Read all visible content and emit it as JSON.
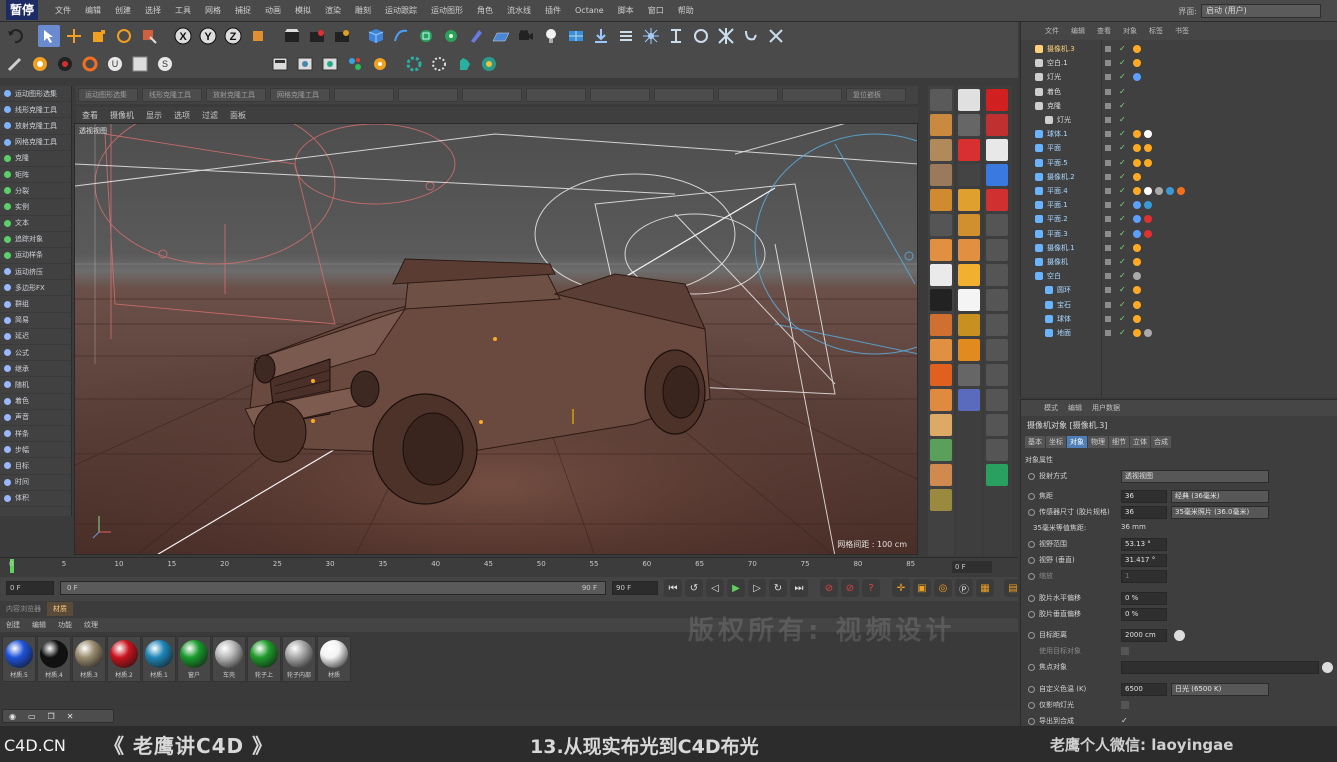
{
  "menubar": {
    "pause_badge": "暂停",
    "items": [
      "文件",
      "编辑",
      "创建",
      "选择",
      "工具",
      "网格",
      "捕捉",
      "动画",
      "模拟",
      "渲染",
      "雕刻",
      "运动跟踪",
      "运动图形",
      "角色",
      "流水线",
      "插件",
      "Octane",
      "脚本",
      "窗口",
      "帮助"
    ],
    "layout_label": "界面:",
    "layout_value": "启动 (用户)"
  },
  "toolbar1": {
    "axis_x": "X",
    "axis_y": "Y",
    "axis_z": "Z"
  },
  "row3": [
    "运动图形选集",
    "线形克隆工具",
    "放射克隆工具",
    "网格克隆工具",
    "",
    "",
    "",
    "",
    "",
    "",
    "",
    "",
    "复位嵌板"
  ],
  "left_panel": {
    "items": [
      {
        "label": "运动图形选集",
        "color": "#7fb2ff"
      },
      {
        "label": "线形克隆工具",
        "color": "#7fb2ff"
      },
      {
        "label": "放射克隆工具",
        "color": "#7fb2ff"
      },
      {
        "label": "网格克隆工具",
        "color": "#7fb2ff"
      },
      {
        "label": "克隆",
        "color": "#5ad06a"
      },
      {
        "label": "矩阵",
        "color": "#5ad06a"
      },
      {
        "label": "分裂",
        "color": "#5ad06a"
      },
      {
        "label": "实例",
        "color": "#5ad06a"
      },
      {
        "label": "文本",
        "color": "#5ad06a"
      },
      {
        "label": "追踪对象",
        "color": "#5ad06a"
      },
      {
        "label": "运动样条",
        "color": "#5ad06a"
      },
      {
        "label": "运动挤压",
        "color": "#9ab7ff"
      },
      {
        "label": "多边形FX",
        "color": "#9ab7ff"
      },
      {
        "label": "群组",
        "color": "#9ab7ff"
      },
      {
        "label": "简易",
        "color": "#9ab7ff"
      },
      {
        "label": "延迟",
        "color": "#9ab7ff"
      },
      {
        "label": "公式",
        "color": "#9ab7ff"
      },
      {
        "label": "继承",
        "color": "#9ab7ff"
      },
      {
        "label": "随机",
        "color": "#9ab7ff"
      },
      {
        "label": "着色",
        "color": "#9ab7ff"
      },
      {
        "label": "声音",
        "color": "#9ab7ff"
      },
      {
        "label": "样条",
        "color": "#9ab7ff"
      },
      {
        "label": "步幅",
        "color": "#9ab7ff"
      },
      {
        "label": "目标",
        "color": "#9ab7ff"
      },
      {
        "label": "时间",
        "color": "#9ab7ff"
      },
      {
        "label": "体积",
        "color": "#9ab7ff"
      }
    ]
  },
  "viewport": {
    "menu": [
      "查看",
      "摄像机",
      "显示",
      "选项",
      "过滤",
      "面板"
    ],
    "view_name": "透视视图",
    "grid_spacing": "网格间距 : 100 cm"
  },
  "timeline": {
    "ticks": [
      "0",
      "5",
      "10",
      "15",
      "20",
      "25",
      "30",
      "35",
      "40",
      "45",
      "50",
      "55",
      "60",
      "65",
      "70",
      "75",
      "80",
      "85",
      "90"
    ],
    "current": "0 F",
    "start": "0 F",
    "range_start": "0 F",
    "range_end": "90 F",
    "end": "90 F"
  },
  "materials": {
    "tabs": [
      "内容浏览器",
      "材质"
    ],
    "active_tab": "材质",
    "menu": [
      "创建",
      "编辑",
      "功能",
      "纹理"
    ],
    "items": [
      {
        "name": "材质.5",
        "color": "#1e52d8"
      },
      {
        "name": "材质.4",
        "color": "#111111"
      },
      {
        "name": "材质.3",
        "color": "#9a8c70"
      },
      {
        "name": "材质.2",
        "color": "#c8131d"
      },
      {
        "name": "材质.1",
        "color": "#1f86b8"
      },
      {
        "name": "窗户",
        "color": "#1a9a2d"
      },
      {
        "name": "车壳",
        "color": "#b9b9b9"
      },
      {
        "name": "轮子上",
        "color": "#1f9b2a"
      },
      {
        "name": "轮子内部",
        "color": "#a9a9a9"
      },
      {
        "name": "材质",
        "color": "#f3f3f3"
      }
    ]
  },
  "objects": {
    "menu": [
      "文件",
      "编辑",
      "查看",
      "对象",
      "标签",
      "书签"
    ],
    "rows": [
      {
        "name": "摄像机.3",
        "style": "sel",
        "indent": 0
      },
      {
        "name": "空白.1",
        "style": "plain",
        "indent": 0
      },
      {
        "name": "灯光",
        "style": "plain",
        "indent": 0
      },
      {
        "name": "着色",
        "style": "plain",
        "indent": 0
      },
      {
        "name": "克隆",
        "style": "plain",
        "indent": 0
      },
      {
        "name": "灯光",
        "style": "plain",
        "indent": 1
      },
      {
        "name": "球体.1",
        "style": "blue",
        "indent": 0
      },
      {
        "name": "平面",
        "style": "blue",
        "indent": 0
      },
      {
        "name": "平面.5",
        "style": "blue",
        "indent": 0
      },
      {
        "name": "摄像机.2",
        "style": "blue",
        "indent": 0
      },
      {
        "name": "平面.4",
        "style": "blue",
        "indent": 0
      },
      {
        "name": "平面.1",
        "style": "blue",
        "indent": 0
      },
      {
        "name": "平面.2",
        "style": "blue",
        "indent": 0
      },
      {
        "name": "平面.3",
        "style": "blue",
        "indent": 0
      },
      {
        "name": "摄像机.1",
        "style": "blue",
        "indent": 0
      },
      {
        "name": "摄像机",
        "style": "blue",
        "indent": 0
      },
      {
        "name": "空白",
        "style": "blue",
        "indent": 0
      },
      {
        "name": "圆环",
        "style": "blue",
        "indent": 1
      },
      {
        "name": "宝石",
        "style": "blue",
        "indent": 1
      },
      {
        "name": "球体",
        "style": "blue",
        "indent": 1
      },
      {
        "name": "地面",
        "style": "blue",
        "indent": 1
      }
    ]
  },
  "attributes": {
    "menu": [
      "模式",
      "编辑",
      "用户数据"
    ],
    "title": "摄像机对象 [摄像机.3]",
    "tabs": [
      "基本",
      "坐标",
      "对象",
      "物理",
      "细节",
      "立体",
      "合成"
    ],
    "active_tab": "对象",
    "section": "对象属性",
    "projection_label": "投射方式",
    "projection_value": "透视视图",
    "focal_label": "焦距",
    "focal_value": "36",
    "focal_preset": "经典 (36毫米)",
    "sensor_label": "传感器尺寸 (胶片规格)",
    "sensor_value": "36",
    "sensor_preset": "35毫米照片 (36.0毫米)",
    "equiv_label": "35毫米等值焦距:",
    "equiv_value": "36 mm",
    "fov_label": "视野范围",
    "fov_value": "53.13 °",
    "fovv_label": "视野 (垂直)",
    "fovv_value": "31.417 °",
    "zoom_label": "缩放",
    "zoom_value": "1",
    "offx_label": "胶片水平偏移",
    "offx_value": "0 %",
    "offy_label": "胶片垂直偏移",
    "offy_value": "0 %",
    "target_label": "目标距离",
    "target_value": "2000 cm",
    "use_target_label": "使用目标对象",
    "focus_obj_label": "焦点对象",
    "wb_label": "自定义色温 (K)",
    "wb_value": "6500",
    "wb_preset": "日光 (6500 K)",
    "only_light_label": "仅影响灯光",
    "export_label": "导出到合成"
  },
  "watermark": "版权所有: 视频设计",
  "footer": {
    "brand": "C4D.CN",
    "title": "《 老鹰讲C4D 》",
    "episode": "13.从现实布光到C4D布光",
    "wechat": "老鹰个人微信: laoyingae"
  }
}
